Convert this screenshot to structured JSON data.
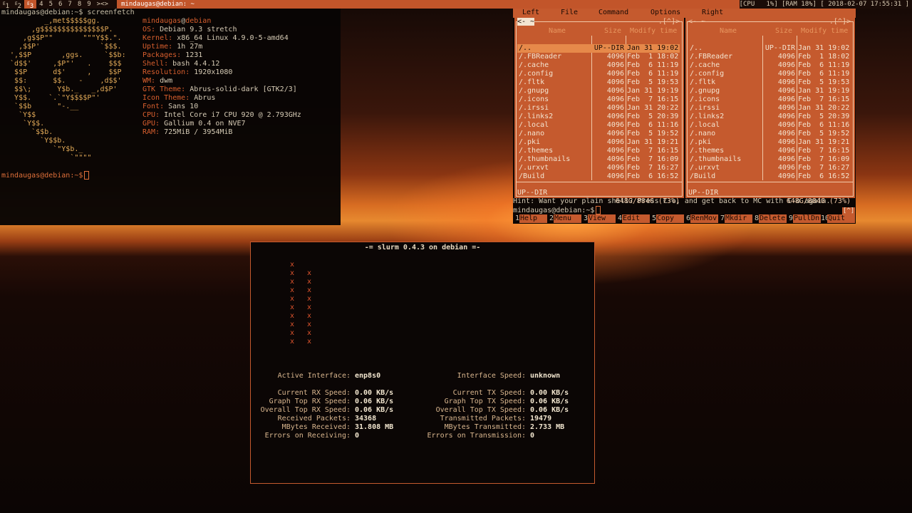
{
  "bar": {
    "tags": [
      {
        "label": "1",
        "sup": "E"
      },
      {
        "label": "2",
        "sup": "E"
      },
      {
        "label": "3",
        "sup": "E"
      },
      {
        "label": "4"
      },
      {
        "label": "5"
      },
      {
        "label": "6"
      },
      {
        "label": "7"
      },
      {
        "label": "8"
      },
      {
        "label": "9"
      }
    ],
    "layout_symbol": "><>",
    "window_title": "mindaugas@debian: ~",
    "status": "[CPU   1%] [RAM 18%] [ 2018-02-07 17:55:31 ]"
  },
  "terminal": {
    "prompt1": "mindaugas@debian:~$ screenfetch",
    "logo": "          _,met$$$$$gg.\n       ,g$$$$$$$$$$$$$$$P.\n     ,g$$P\"\"       \"\"\"Y$$.\".\n    ,$$P'              `$$$.\n  ',$$P       ,ggs.     `$$b:\n  `d$$'     ,$P\"'   .    $$$\n   $$P      d$'     ,    $$P\n   $$:      $$.   -    ,d$$'\n   $$\\;      Y$b._   _,d$P'\n   Y$$.    `.`\"Y$$$$P\"'\n   `$$b      \"-.__\n    `Y$$\n     `Y$$.\n       `$$b.\n         `Y$$b.\n            `\"Y$b._\n                `\"\"\"\"",
    "info_title_user": "mindaugas",
    "info_title_host": "debian",
    "info": [
      {
        "k": "OS:",
        "v": "Debian 9.3 stretch"
      },
      {
        "k": "Kernel:",
        "v": "x86_64 Linux 4.9.0-5-amd64"
      },
      {
        "k": "Uptime:",
        "v": "1h 27m"
      },
      {
        "k": "Packages:",
        "v": "1231"
      },
      {
        "k": "Shell:",
        "v": "bash 4.4.12"
      },
      {
        "k": "Resolution:",
        "v": "1920x1080"
      },
      {
        "k": "WM:",
        "v": "dwm"
      },
      {
        "k": "GTK Theme:",
        "v": "Abrus-solid-dark [GTK2/3]"
      },
      {
        "k": "Icon Theme:",
        "v": "Abrus"
      },
      {
        "k": "Font:",
        "v": "Sans 10"
      },
      {
        "k": "CPU:",
        "v": "Intel Core i7 CPU 920 @ 2.793GHz"
      },
      {
        "k": "GPU:",
        "v": "Gallium 0.4 on NVE7"
      },
      {
        "k": "RAM:",
        "v": "725MiB / 3954MiB"
      }
    ],
    "prompt2": "mindaugas@debian:~$"
  },
  "mc": {
    "menu": [
      "Left",
      "File",
      "Command",
      "Options",
      "Right"
    ],
    "left_header": "<- ~",
    "right_header": "<- ~",
    "header_right": ".[^]>",
    "col_headers": [
      "Name",
      "Size",
      "Modify time"
    ],
    "rows": [
      {
        "name": "/..",
        "size": "UP--DIR",
        "date": "Jan 31 19:02"
      },
      {
        "name": "/.FBReader",
        "size": "4096",
        "date": "Feb  1 18:02"
      },
      {
        "name": "/.cache",
        "size": "4096",
        "date": "Feb  6 11:19"
      },
      {
        "name": "/.config",
        "size": "4096",
        "date": "Feb  6 11:19"
      },
      {
        "name": "/.fltk",
        "size": "4096",
        "date": "Feb  5 19:53"
      },
      {
        "name": "/.gnupg",
        "size": "4096",
        "date": "Jan 31 19:19"
      },
      {
        "name": "/.icons",
        "size": "4096",
        "date": "Feb  7 16:15"
      },
      {
        "name": "/.irssi",
        "size": "4096",
        "date": "Jan 31 20:22"
      },
      {
        "name": "/.links2",
        "size": "4096",
        "date": "Feb  5 20:39"
      },
      {
        "name": "/.local",
        "size": "4096",
        "date": "Feb  6 11:16"
      },
      {
        "name": "/.nano",
        "size": "4096",
        "date": "Feb  5 19:52"
      },
      {
        "name": "/.pki",
        "size": "4096",
        "date": "Jan 31 19:21"
      },
      {
        "name": "/.themes",
        "size": "4096",
        "date": "Feb  7 16:15"
      },
      {
        "name": "/.thumbnails",
        "size": "4096",
        "date": "Feb  7 16:09"
      },
      {
        "name": "/.urxvt",
        "size": "4096",
        "date": "Feb  7 16:27"
      },
      {
        "name": "/Build",
        "size": "4096",
        "date": "Feb  6 16:52"
      }
    ],
    "mini_status": "UP--DIR",
    "disk": "648G/884G (73%)",
    "hint": "Hint: Want your plain shell? Press C-o, and get back to MC with C-o again.",
    "prompt": "mindaugas@debian:~$",
    "mini_icon": "[^]",
    "fkeys": [
      {
        "n": "1",
        "l": "Help"
      },
      {
        "n": "2",
        "l": "Menu"
      },
      {
        "n": "3",
        "l": "View"
      },
      {
        "n": "4",
        "l": "Edit"
      },
      {
        "n": "5",
        "l": "Copy"
      },
      {
        "n": "6",
        "l": "RenMov"
      },
      {
        "n": "7",
        "l": "Mkdir"
      },
      {
        "n": "8",
        "l": "Delete"
      },
      {
        "n": "9",
        "l": "PullDn"
      },
      {
        "n": "10",
        "l": "Quit"
      }
    ]
  },
  "slurm": {
    "title": "-= slurm 0.4.3 on debian =-",
    "graph_mark": "x",
    "graph_col1_count": 10,
    "graph_col2_count": 9,
    "left": [
      {
        "l": "Active Interface:",
        "v": "enp8s0"
      },
      {
        "l": "",
        "v": ""
      },
      {
        "l": "Current RX Speed:",
        "v": "0.00 KB/s"
      },
      {
        "l": "Graph Top RX Speed:",
        "v": "0.06 KB/s"
      },
      {
        "l": "Overall Top RX Speed:",
        "v": "0.06 KB/s"
      },
      {
        "l": "Received Packets:",
        "v": "34368"
      },
      {
        "l": "MBytes Received:",
        "v": "31.808 MB"
      },
      {
        "l": "Errors on Receiving:",
        "v": "0"
      }
    ],
    "right": [
      {
        "l": "Interface Speed:",
        "v": "unknown"
      },
      {
        "l": "",
        "v": ""
      },
      {
        "l": "Current TX Speed:",
        "v": "0.00 KB/s"
      },
      {
        "l": "Graph Top TX Speed:",
        "v": "0.06 KB/s"
      },
      {
        "l": "Overall Top TX Speed:",
        "v": "0.06 KB/s"
      },
      {
        "l": "Transmitted Packets:",
        "v": "19479"
      },
      {
        "l": "MBytes Transmitted:",
        "v": "2.733 MB"
      },
      {
        "l": "Errors on Transmission:",
        "v": "0"
      }
    ]
  }
}
